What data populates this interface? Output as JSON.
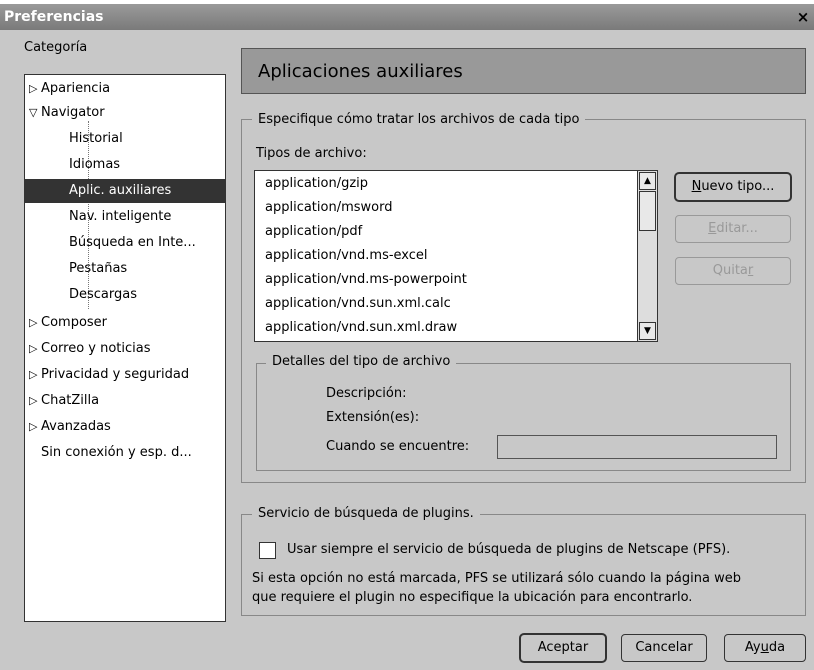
{
  "window": {
    "title": "Preferencias",
    "close_label": "×"
  },
  "sidebar": {
    "label": "Categoría",
    "items": [
      {
        "label": "Apariencia",
        "twisty": "▷"
      },
      {
        "label": "Navigator",
        "twisty": "▽"
      },
      {
        "label": "Historial"
      },
      {
        "label": "Idiomas"
      },
      {
        "label": "Aplic. auxiliares"
      },
      {
        "label": "Nav. inteligente"
      },
      {
        "label": "Búsqueda en Inte..."
      },
      {
        "label": "Pestañas"
      },
      {
        "label": "Descargas"
      },
      {
        "label": "Composer",
        "twisty": "▷"
      },
      {
        "label": "Correo y noticias",
        "twisty": "▷"
      },
      {
        "label": "Privacidad y seguridad",
        "twisty": "▷"
      },
      {
        "label": "ChatZilla",
        "twisty": "▷"
      },
      {
        "label": "Avanzadas",
        "twisty": "▷"
      },
      {
        "label": "Sin conexión y esp. d..."
      }
    ]
  },
  "panel": {
    "title": "Aplicaciones auxiliares",
    "group_title": "Especifique cómo tratar los archivos de cada tipo",
    "types_label": "Tipos de archivo:",
    "types": [
      "application/gzip",
      "application/msword",
      "application/pdf",
      "application/vnd.ms-excel",
      "application/vnd.ms-powerpoint",
      "application/vnd.sun.xml.calc",
      "application/vnd.sun.xml.draw"
    ],
    "buttons": {
      "new_pre": "",
      "new_key": "N",
      "new_post": "uevo tipo...",
      "edit_pre": "",
      "edit_key": "E",
      "edit_post": "ditar...",
      "remove_pre": "Quita",
      "remove_key": "r",
      "remove_post": ""
    },
    "details": {
      "title": "Detalles del tipo de archivo",
      "description_label": "Descripción:",
      "extension_label": "Extensión(es):",
      "when_found_label": "Cuando se encuentre:",
      "when_found_value": ""
    },
    "plugins": {
      "title": "Servicio de búsqueda de plugins.",
      "checkbox_label": "Usar siempre el servicio de búsqueda de plugins de Netscape (PFS).",
      "checked": false,
      "note_line1": "Si esta opción no está marcada, PFS se utilizará sólo cuando la página web",
      "note_line2": "que requiere el plugin no especifique la ubicación para encontrarlo."
    }
  },
  "footer": {
    "ok": "Aceptar",
    "cancel": "Cancelar",
    "help_pre": "Ay",
    "help_key": "u",
    "help_post": "da"
  },
  "scrollbar": {
    "up": "▲",
    "down": "▼"
  }
}
